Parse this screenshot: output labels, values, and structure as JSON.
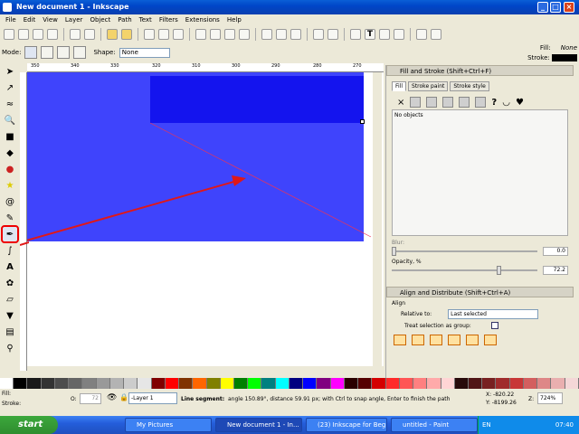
{
  "window": {
    "title": "New document 1 - Inkscape"
  },
  "menubar": {
    "items": [
      "File",
      "Edit",
      "View",
      "Layer",
      "Object",
      "Path",
      "Text",
      "Filters",
      "Extensions",
      "Help"
    ]
  },
  "style_indicator": {
    "fill_label": "Fill:",
    "fill_value": "None",
    "stroke_label": "Stroke:"
  },
  "modebar": {
    "mode_label": "Mode:",
    "shape_label": "Shape:",
    "shape_value": "None"
  },
  "ruler": {
    "ticks": [
      "350",
      "340",
      "330",
      "320",
      "310",
      "300",
      "290",
      "280",
      "270"
    ]
  },
  "fill_stroke_panel": {
    "title": "Fill and Stroke (Shift+Ctrl+F)",
    "tabs": [
      "Fill",
      "Stroke paint",
      "Stroke style"
    ],
    "no_objects": "No objects",
    "blur_label": "Blur:",
    "blur_value": "0.0",
    "opacity_label": "Opacity, %",
    "opacity_value": "72.2",
    "opacity_fraction": 0.72
  },
  "align_panel": {
    "title": "Align and Distribute (Shift+Ctrl+A)",
    "align_label": "Align",
    "relative_label": "Relative to:",
    "relative_value": "Last selected",
    "treat_group_label": "Treat selection as group:"
  },
  "statusbar": {
    "fill_label": "Fill:",
    "stroke_label": "Stroke:",
    "opacity_label": "O:",
    "opacity_value": "72",
    "layer_value": "-Layer 1",
    "message_bold": "Line segment:",
    "message": "angle 150.89°, distance 59.91 px; with Ctrl to snap angle, Enter to finish the path",
    "coords": "X: -820.22\nY: -8199.26",
    "zoom_label": "Z:",
    "zoom_value": "724%"
  },
  "taskbar": {
    "start_label": "start",
    "tasks": [
      "My Pictures",
      "New document 1 - In...",
      "(23) Inkscape for Beg...",
      "untitled - Paint"
    ],
    "lang": "EN",
    "clock": "07:40"
  },
  "colors": {
    "canvas_blue": "#3f44fc",
    "canvas_dark_blue": "#1414ee",
    "annotation_red": "#e01818"
  }
}
